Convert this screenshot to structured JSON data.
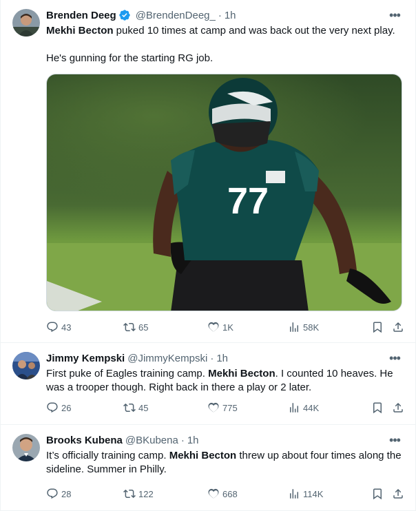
{
  "tweets": [
    {
      "name": "Brenden Deeg",
      "verified": true,
      "handle": "@BrendenDeeg_",
      "time": "1h",
      "text_bold": "Mekhi Becton",
      "text_rest": " puked 10 times at camp and was back out the very next play.",
      "text_line2": "He's gunning for the starting RG job.",
      "media": {
        "jersey_number": "77"
      },
      "stats": {
        "replies": "43",
        "retweets": "65",
        "likes": "1K",
        "views": "58K"
      }
    },
    {
      "name": "Jimmy Kempski",
      "handle": "@JimmyKempski",
      "time": "1h",
      "text_pre": "First puke of Eagles training camp. ",
      "text_bold": "Mekhi Becton",
      "text_post": ". I counted 10 heaves. He was a trooper though. Right back in there a play or 2 later.",
      "stats": {
        "replies": "26",
        "retweets": "45",
        "likes": "775",
        "views": "44K"
      }
    },
    {
      "name": "Brooks Kubena",
      "handle": "@BKubena",
      "time": "1h",
      "text_pre": "It’s officially training camp. ",
      "text_bold": "Mekhi Becton",
      "text_post": " threw up about four times along the sideline. Summer in Philly.",
      "stats": {
        "replies": "28",
        "retweets": "122",
        "likes": "668",
        "views": "114K"
      }
    }
  ],
  "colors": {
    "text": "#0f1419",
    "muted": "#536471",
    "verified": "#1d9bf0",
    "border": "#eff3f4"
  },
  "icons": [
    "reply-icon",
    "retweet-icon",
    "like-icon",
    "views-icon",
    "bookmark-icon",
    "share-icon",
    "more-icon",
    "verified-icon"
  ]
}
